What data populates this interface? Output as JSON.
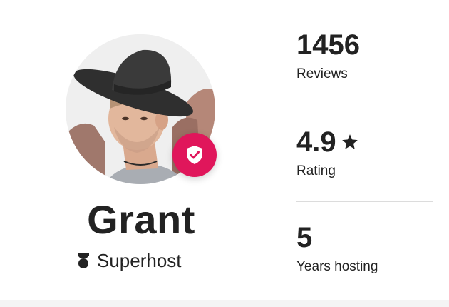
{
  "host": {
    "name": "Grant",
    "superhost_label": "Superhost",
    "verified": true
  },
  "stats": [
    {
      "value": "1456",
      "label": "Reviews"
    },
    {
      "value": "4.9",
      "label": "Rating",
      "icon": "star-icon"
    },
    {
      "value": "5",
      "label": "Years hosting"
    }
  ],
  "icons": {
    "verified": "shield-check-icon",
    "superhost": "superhost-medal-icon",
    "rating": "star-icon"
  },
  "colors": {
    "badge": "#e0165b",
    "text": "#222222",
    "divider": "#dcdcdc"
  }
}
